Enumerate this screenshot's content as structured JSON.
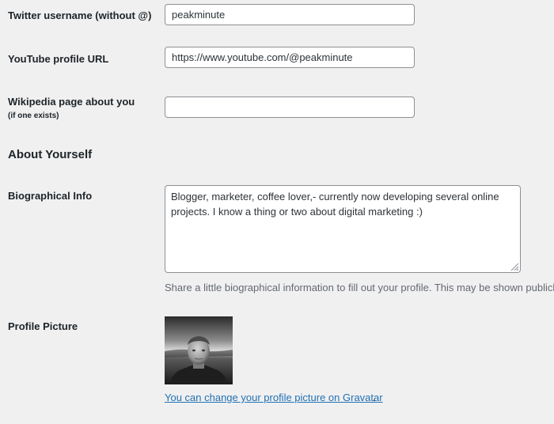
{
  "fields": {
    "twitter": {
      "label": "Twitter username (without @)",
      "value": "peakminute"
    },
    "youtube": {
      "label": "YouTube profile URL",
      "value": "https://www.youtube.com/@peakminute"
    },
    "wikipedia": {
      "label": "Wikipedia page about you",
      "sublabel": "(if one exists)",
      "value": ""
    }
  },
  "about": {
    "title": "About Yourself",
    "bio": {
      "label": "Biographical Info",
      "value": "Blogger, marketer, coffee lover,- currently now developing several online projects. I know a thing or two about digital marketing :)",
      "description": "Share a little biographical information to fill out your profile. This may be shown publicly."
    },
    "picture": {
      "label": "Profile Picture",
      "link_text": "You can change your profile picture on Gravatar",
      "link_suffix": "."
    }
  },
  "colors": {
    "background": "#f0f0f1",
    "link": "#2271b1",
    "border": "#8c8f94",
    "muted_text": "#646970"
  }
}
